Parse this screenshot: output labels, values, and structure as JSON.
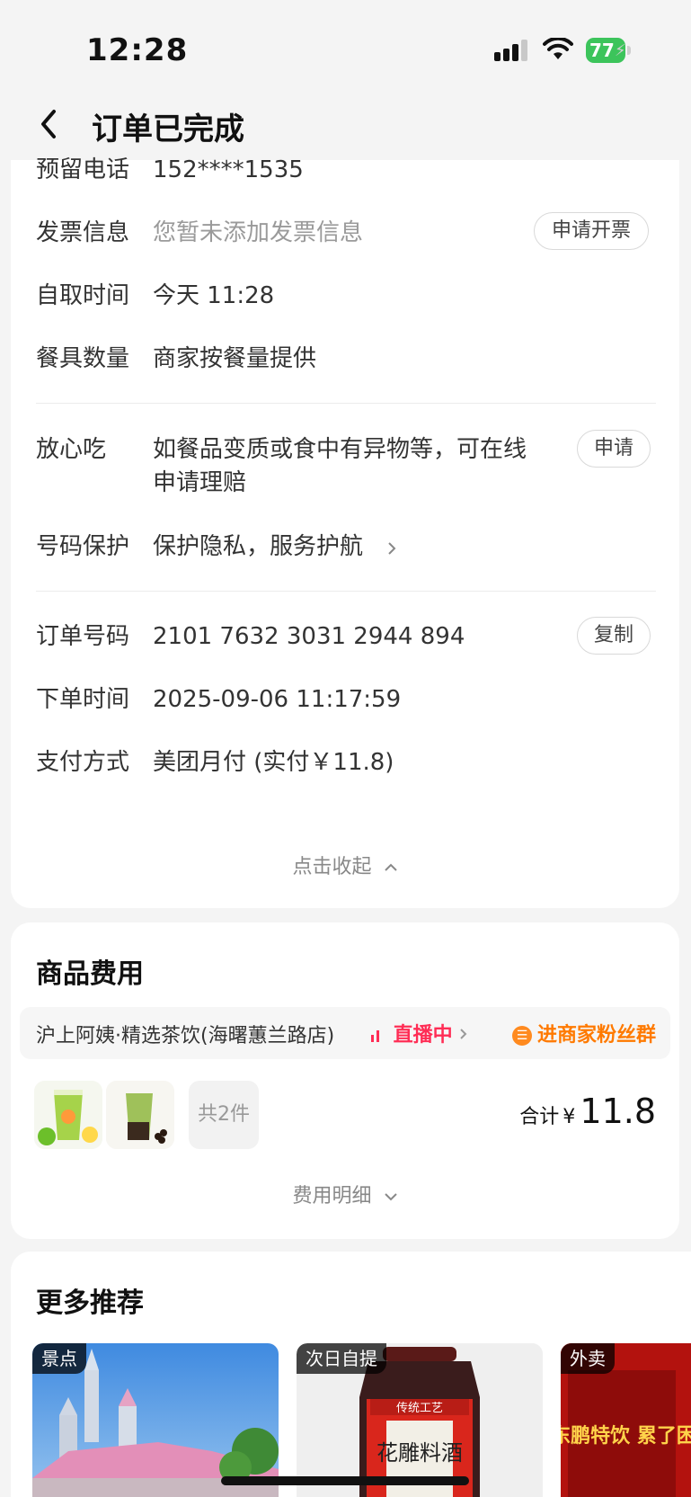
{
  "status_bar": {
    "time": "12:28",
    "battery": "77"
  },
  "header": {
    "title": "订单已完成"
  },
  "order_info": {
    "rows": [
      {
        "label": "预留电话",
        "value": "152****1535"
      },
      {
        "label": "发票信息",
        "value": "您暂未添加发票信息",
        "button": "申请开票"
      },
      {
        "label": "自取时间",
        "value": "今天 11:28"
      },
      {
        "label": "餐具数量",
        "value": "商家按餐量提供"
      }
    ],
    "safe_eat": {
      "label": "放心吃",
      "line1": "如餐品变质或食中有异物等，可在线",
      "line2": "申请理赔",
      "button": "申请"
    },
    "number_protect": {
      "label": "号码保护",
      "value": "保护隐私，服务护航"
    },
    "order_no": {
      "label": "订单号码",
      "value": "2101 7632 3031 2944 894",
      "button": "复制"
    },
    "order_time": {
      "label": "下单时间",
      "value": "2025-09-06 11:17:59"
    },
    "payment": {
      "label": "支付方式",
      "value": "美团月付 (实付￥11.8)"
    },
    "collapse_label": "点击收起"
  },
  "goods": {
    "title": "商品费用",
    "store_name": "沪上阿姨·精选茶饮(海曙蕙兰路店)",
    "live_label": "直播中",
    "fans_label": "进商家粉丝群",
    "item_count": "共2件",
    "total_label": "合计",
    "currency": "¥",
    "total_value": "11.8",
    "detail_label": "费用明细"
  },
  "recommend": {
    "title": "更多推荐",
    "cards": [
      {
        "tag": "景点"
      },
      {
        "tag": "次日自提",
        "label_top": "传统工艺",
        "label_main": "花雕料酒"
      },
      {
        "tag": "外卖",
        "label_main": "鲁东鹏特饮 累了困了"
      }
    ]
  },
  "colors": {
    "accent_orange": "#ff7a00",
    "live_red": "#ff2d55",
    "battery_green": "#3cc45b"
  }
}
